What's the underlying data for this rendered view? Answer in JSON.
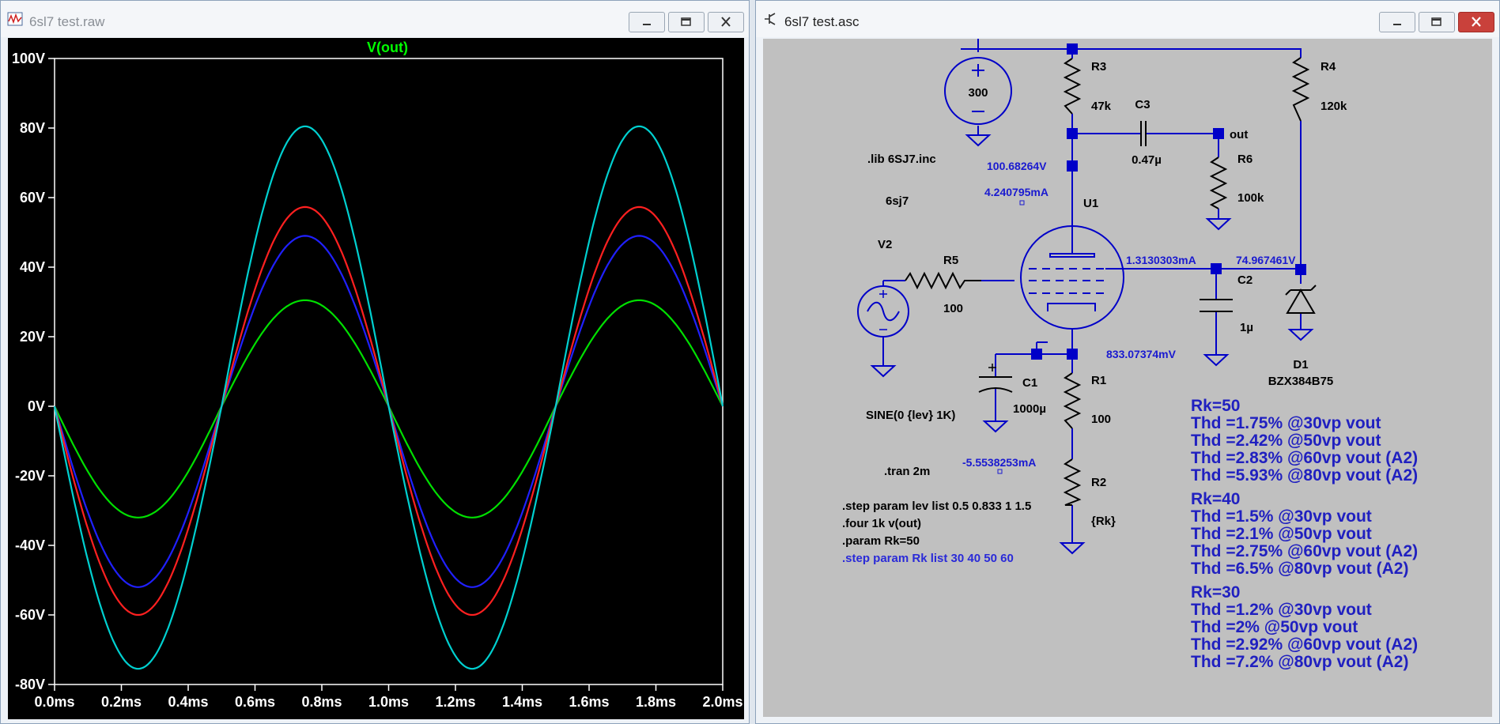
{
  "left_window": {
    "title": "6sl7 test.raw",
    "trace_label": "V(out)"
  },
  "right_window": {
    "title": "6sl7 test.asc"
  },
  "colors": {
    "plot_bg": "#000000",
    "axis": "#ffffff",
    "trace_label": "#00ff00",
    "schematic_bg": "#c0c0c0",
    "wire": "#0000c8",
    "annotation": "#2020c0"
  },
  "chart_data": {
    "type": "line",
    "title": "V(out)",
    "xlabel": "",
    "ylabel": "",
    "xlim": [
      0,
      2.0
    ],
    "ylim": [
      -80,
      100
    ],
    "x_ticks": [
      "0.0ms",
      "0.2ms",
      "0.4ms",
      "0.6ms",
      "0.8ms",
      "1.0ms",
      "1.2ms",
      "1.4ms",
      "1.6ms",
      "1.8ms",
      "2.0ms"
    ],
    "y_ticks": [
      "100V",
      "80V",
      "60V",
      "40V",
      "20V",
      "0V",
      "-20V",
      "-40V",
      "-60V",
      "-80V"
    ],
    "frequency_khz": 1,
    "series": [
      {
        "color": "#00e000",
        "amplitude_pos": 30.5,
        "amplitude_neg": 32.0
      },
      {
        "color": "#2020ff",
        "amplitude_pos": 49.0,
        "amplitude_neg": 52.0
      },
      {
        "color": "#ff2020",
        "amplitude_pos": 57.3,
        "amplitude_neg": 60.0
      },
      {
        "color": "#00d0d0",
        "amplitude_pos": 80.5,
        "amplitude_neg": 75.5
      }
    ]
  },
  "schematic": {
    "components": {
      "v1_value": "300",
      "r3_name": "R3",
      "r3_value": "47k",
      "r4_name": "R4",
      "r4_value": "120k",
      "c3_name": "C3",
      "c3_value": "0.47µ",
      "out_label": "out",
      "r6_name": "R6",
      "r6_value": "100k",
      "u1_name": "U1",
      "v2_name": "V2",
      "r5_name": "R5",
      "r5_value": "100",
      "c2_name": "C2",
      "c2_value": "1µ",
      "d1_name": "D1",
      "d1_value": "BZX384B75",
      "c1_name": "C1",
      "c1_value": "1000µ",
      "r1_name": "R1",
      "r1_value": "100",
      "r2_name": "R2",
      "r2_value": "{Rk}",
      "v2_source": "SINE(0 {lev} 1K)"
    },
    "probes": {
      "plate_voltage": "100.68264V",
      "plate_current": "4.240795mA",
      "screen_current": "1.3130303mA",
      "screen_voltage": "74.967461V",
      "cathode_voltage": "833.07374mV",
      "cathode_current": "-5.5538253mA"
    },
    "directives": {
      "lib": ".lib 6SJ7.inc",
      "model": "6sj7",
      "tran": ".tran 2m",
      "step_lev": ".step param lev list 0.5 0.833 1 1.5",
      "four": ".four 1k v(out)",
      "param": ".param Rk=50",
      "step_rk": ".step param Rk list 30 40 50 60"
    },
    "thd_notes": [
      {
        "heading": "Rk=50",
        "lines": [
          "Thd =1.75% @30vp vout",
          "Thd =2.42% @50vp vout",
          "Thd =2.83% @60vp vout (A2)",
          "Thd =5.93% @80vp vout (A2)"
        ]
      },
      {
        "heading": "Rk=40",
        "lines": [
          "Thd =1.5% @30vp vout",
          "Thd =2.1% @50vp vout",
          "Thd =2.75% @60vp vout (A2)",
          "Thd =6.5% @80vp vout (A2)"
        ]
      },
      {
        "heading": "Rk=30",
        "lines": [
          "Thd =1.2% @30vp vout",
          "Thd =2% @50vp vout",
          "Thd =2.92% @60vp vout (A2)",
          "Thd =7.2% @80vp vout (A2)"
        ]
      }
    ]
  }
}
